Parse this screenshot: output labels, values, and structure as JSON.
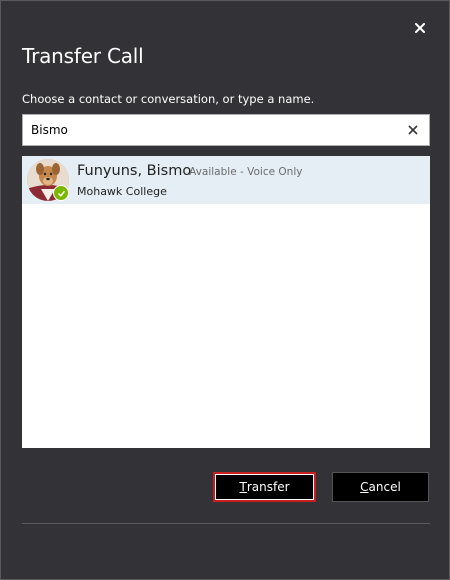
{
  "dialog": {
    "title": "Transfer Call",
    "prompt": "Choose a contact or conversation, or type a name."
  },
  "search": {
    "value": "Bismo",
    "clear_icon": "close-icon"
  },
  "results": [
    {
      "name": "Funyuns, Bismo",
      "status": "- Available - Voice Only",
      "organization": "Mohawk College",
      "presence": "available",
      "presence_color": "#7ab800"
    }
  ],
  "buttons": {
    "transfer": {
      "mnemonic": "T",
      "rest": "ransfer"
    },
    "cancel": {
      "mnemonic": "C",
      "rest": "ancel"
    }
  },
  "colors": {
    "window_bg": "#333337",
    "selected_row_bg": "#e4eef4",
    "focus_border": "#c81e1e"
  }
}
